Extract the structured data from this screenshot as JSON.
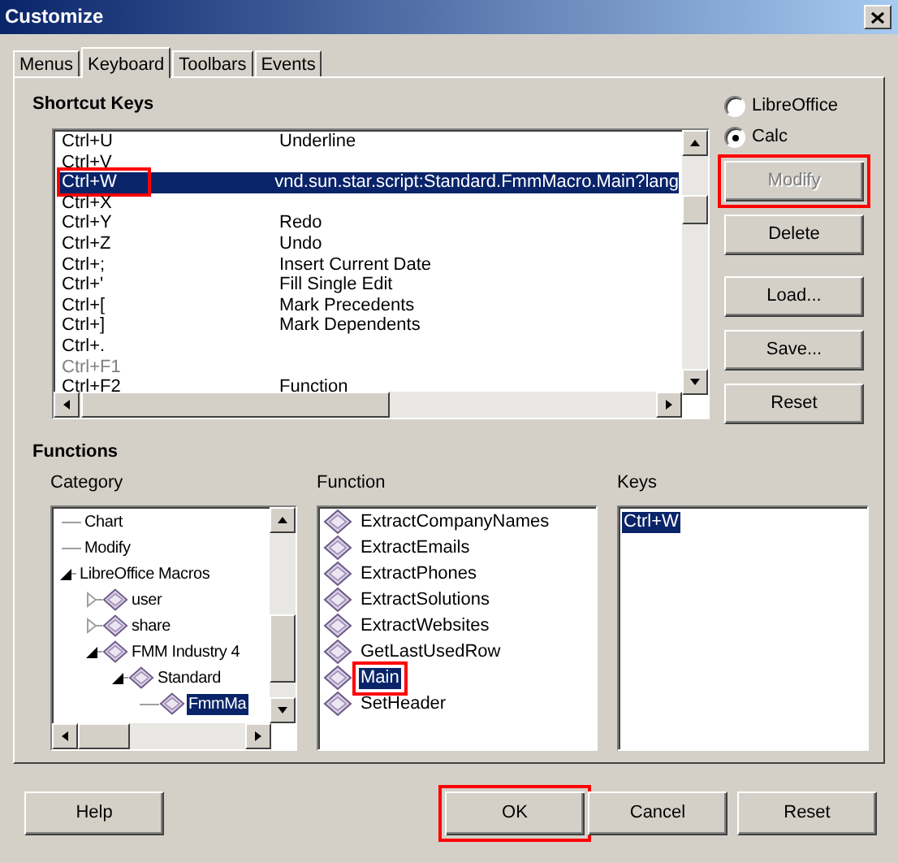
{
  "window": {
    "title": "Customize"
  },
  "tabs": [
    {
      "label": "Menus",
      "selected": false
    },
    {
      "label": "Keyboard",
      "selected": true
    },
    {
      "label": "Toolbars",
      "selected": false
    },
    {
      "label": "Events",
      "selected": false
    }
  ],
  "shortcut_keys": {
    "heading": "Shortcut Keys",
    "rows": [
      {
        "key": "Ctrl+U",
        "function": "Underline",
        "selected": false,
        "disabled": false,
        "highlighted": false
      },
      {
        "key": "Ctrl+V",
        "selected": false,
        "disabled": false,
        "highlighted": false
      },
      {
        "key": "Ctrl+W",
        "function": "vnd.sun.star.script:Standard.FmmMacro.Main?lang",
        "selected": true,
        "disabled": false,
        "highlighted": true
      },
      {
        "key": "Ctrl+X",
        "selected": false,
        "disabled": false,
        "highlighted": false
      },
      {
        "key": "Ctrl+Y",
        "function": "Redo",
        "selected": false,
        "disabled": false,
        "highlighted": false
      },
      {
        "key": "Ctrl+Z",
        "function": "Undo",
        "selected": false,
        "disabled": false,
        "highlighted": false
      },
      {
        "key": "Ctrl+;",
        "function": "Insert Current Date",
        "selected": false,
        "disabled": false,
        "highlighted": false
      },
      {
        "key": "Ctrl+'",
        "function": "Fill Single Edit",
        "selected": false,
        "disabled": false,
        "highlighted": false
      },
      {
        "key": "Ctrl+[",
        "function": "Mark Precedents",
        "selected": false,
        "disabled": false,
        "highlighted": false
      },
      {
        "key": "Ctrl+]",
        "function": "Mark Dependents",
        "selected": false,
        "disabled": false,
        "highlighted": false
      },
      {
        "key": "Ctrl+.",
        "selected": false,
        "disabled": false,
        "highlighted": false
      },
      {
        "key": "Ctrl+F1",
        "selected": false,
        "disabled": true,
        "highlighted": false
      },
      {
        "key": "Ctrl+F2",
        "function": "Function",
        "selected": false,
        "disabled": false,
        "highlighted": false
      }
    ]
  },
  "scope": [
    {
      "label": "LibreOffice",
      "selected": false
    },
    {
      "label": "Calc",
      "selected": true
    }
  ],
  "side_buttons": [
    {
      "label": "Modify",
      "disabled": true,
      "highlighted": true
    },
    {
      "label": "Delete",
      "disabled": false,
      "highlighted": false
    },
    {
      "label": "Load...",
      "disabled": false,
      "highlighted": false
    },
    {
      "label": "Save...",
      "disabled": false,
      "highlighted": false
    },
    {
      "label": "Reset",
      "disabled": false,
      "highlighted": false
    }
  ],
  "functions": {
    "heading": "Functions",
    "category": {
      "label": "Category",
      "tree": [
        {
          "label": "Chart",
          "kind": "category",
          "selected": false
        },
        {
          "label": "Modify",
          "kind": "category",
          "selected": false
        },
        {
          "label": "LibreOffice Macros",
          "kind": "category",
          "expanded": true,
          "selected": false,
          "children": [
            {
              "label": "user",
              "kind": "library",
              "expanded": false,
              "selected": false
            },
            {
              "label": "share",
              "kind": "library",
              "expanded": false,
              "selected": false
            },
            {
              "label": "FMM Industry 4",
              "kind": "library",
              "expanded": true,
              "selected": false,
              "children": [
                {
                  "label": "Standard",
                  "kind": "library",
                  "expanded": true,
                  "selected": false,
                  "children": [
                    {
                      "label": "FmmMa",
                      "kind": "library",
                      "selected": true
                    }
                  ]
                }
              ]
            }
          ]
        }
      ]
    },
    "function": {
      "label": "Function",
      "items": [
        {
          "label": "ExtractCompanyNames",
          "selected": false,
          "highlighted": false
        },
        {
          "label": "ExtractEmails",
          "selected": false,
          "highlighted": false
        },
        {
          "label": "ExtractPhones",
          "selected": false,
          "highlighted": false
        },
        {
          "label": "ExtractSolutions",
          "selected": false,
          "highlighted": false
        },
        {
          "label": "ExtractWebsites",
          "selected": false,
          "highlighted": false
        },
        {
          "label": "GetLastUsedRow",
          "selected": false,
          "highlighted": false
        },
        {
          "label": "Main",
          "selected": true,
          "highlighted": true
        },
        {
          "label": "SetHeader",
          "selected": false,
          "highlighted": false
        }
      ]
    },
    "keys": {
      "label": "Keys",
      "items": [
        {
          "label": "Ctrl+W",
          "selected": true
        }
      ]
    }
  },
  "buttons_left": [
    {
      "label": "Help",
      "highlighted": false
    }
  ],
  "buttons_right": [
    {
      "label": "OK",
      "highlighted": true
    },
    {
      "label": "Cancel",
      "highlighted": false
    },
    {
      "label": "Reset",
      "highlighted": false
    }
  ]
}
